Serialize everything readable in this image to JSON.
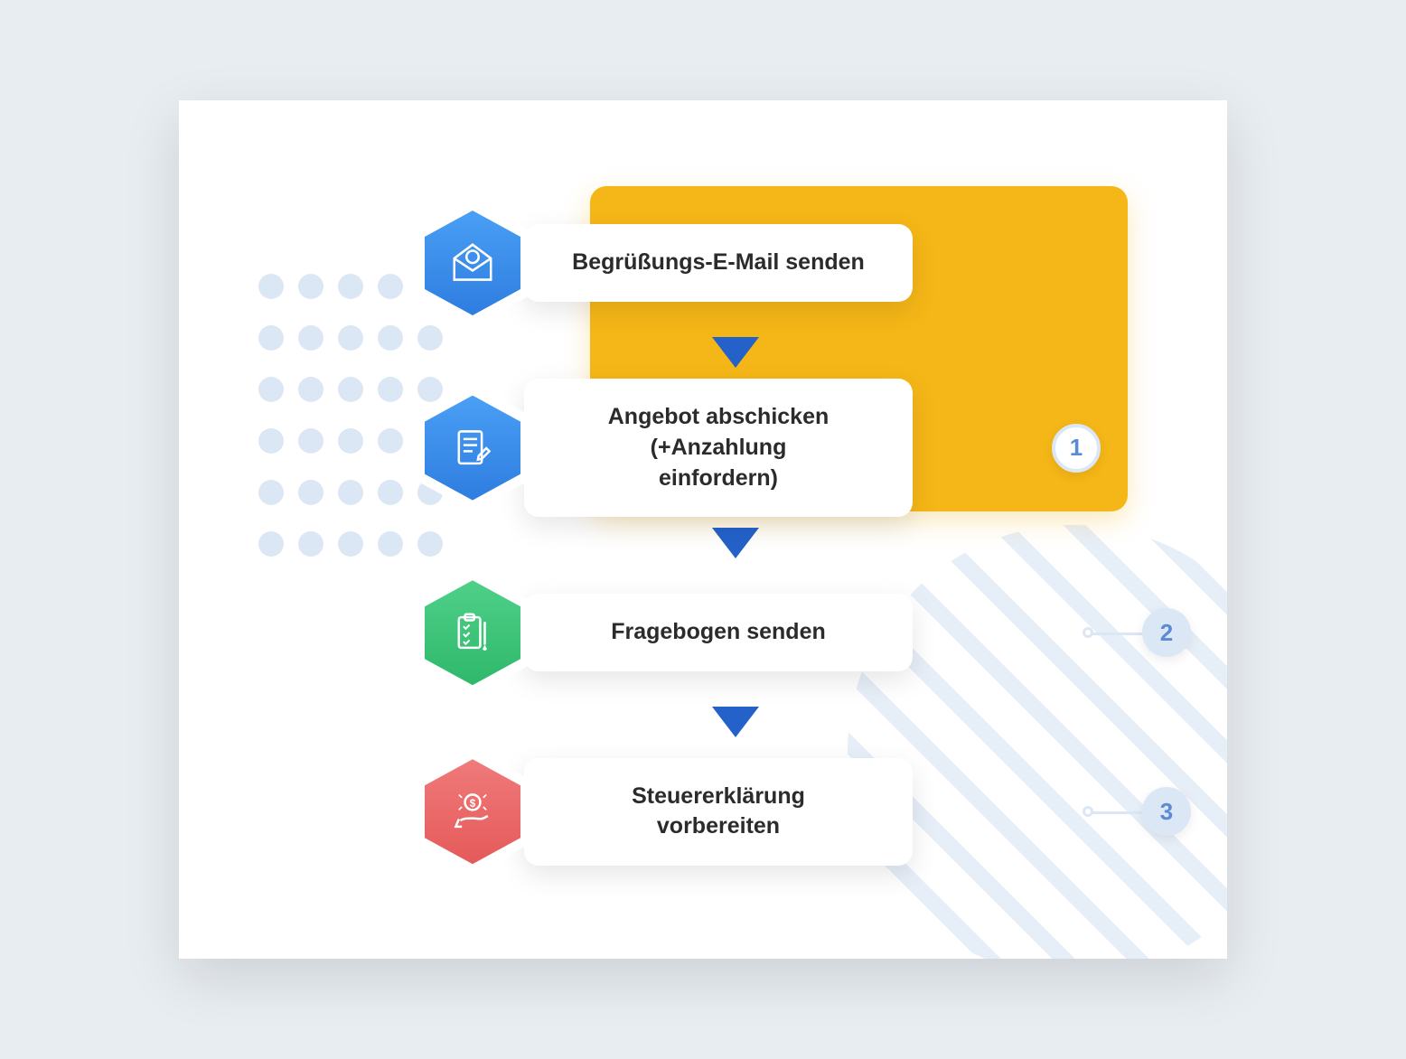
{
  "workflow": {
    "steps": [
      {
        "label": "Begrüßungs-E-Mail senden",
        "icon": "envelope-at-icon",
        "color": "blue",
        "badge": ""
      },
      {
        "label": "Angebot abschicken\n(+Anzahlung\neinfordern)",
        "icon": "document-sign-icon",
        "color": "blue",
        "badge": "1"
      },
      {
        "label": "Fragebogen senden",
        "icon": "clipboard-check-icon",
        "color": "green",
        "badge": "2"
      },
      {
        "label": "Steuererklärung\nvorbereiten",
        "icon": "money-hand-icon",
        "color": "red",
        "badge": "3"
      }
    ]
  },
  "colors": {
    "accent_yellow": "#f5b617",
    "blue": "#3a88e8",
    "green": "#3cc679",
    "red": "#e86868",
    "light_blue": "#dce7f5",
    "arrow": "#2461c9"
  }
}
